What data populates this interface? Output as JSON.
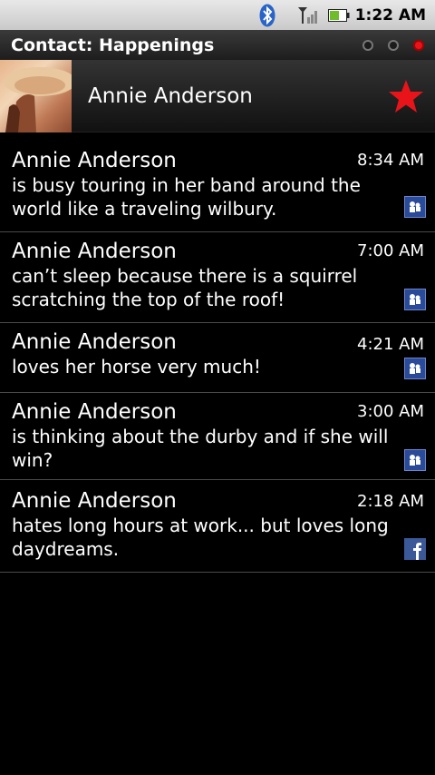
{
  "status_bar": {
    "time": "1:22 AM"
  },
  "title_bar": {
    "title": "Contact: Happenings"
  },
  "contact": {
    "name": "Annie Anderson",
    "favorite": true
  },
  "feed": [
    {
      "name": "Annie Anderson",
      "time": "8:34 AM",
      "message": "is busy touring in her band around the world like a traveling wilbury.",
      "source": "myspace-icon"
    },
    {
      "name": "Annie Anderson",
      "time": "7:00 AM",
      "message": "can’t sleep because there is a squirrel scratching the top of the roof!",
      "source": "myspace-icon"
    },
    {
      "name": "Annie Anderson",
      "time": "4:21 AM",
      "message": "loves her horse very much!",
      "source": "myspace-icon"
    },
    {
      "name": "Annie Anderson",
      "time": "3:00 AM",
      "message": "is thinking about the durby and if she will win?",
      "source": "myspace-icon"
    },
    {
      "name": "Annie Anderson",
      "time": "2:18 AM",
      "message": "hates long hours at work... but loves long daydreams.",
      "source": "facebook-icon"
    }
  ]
}
